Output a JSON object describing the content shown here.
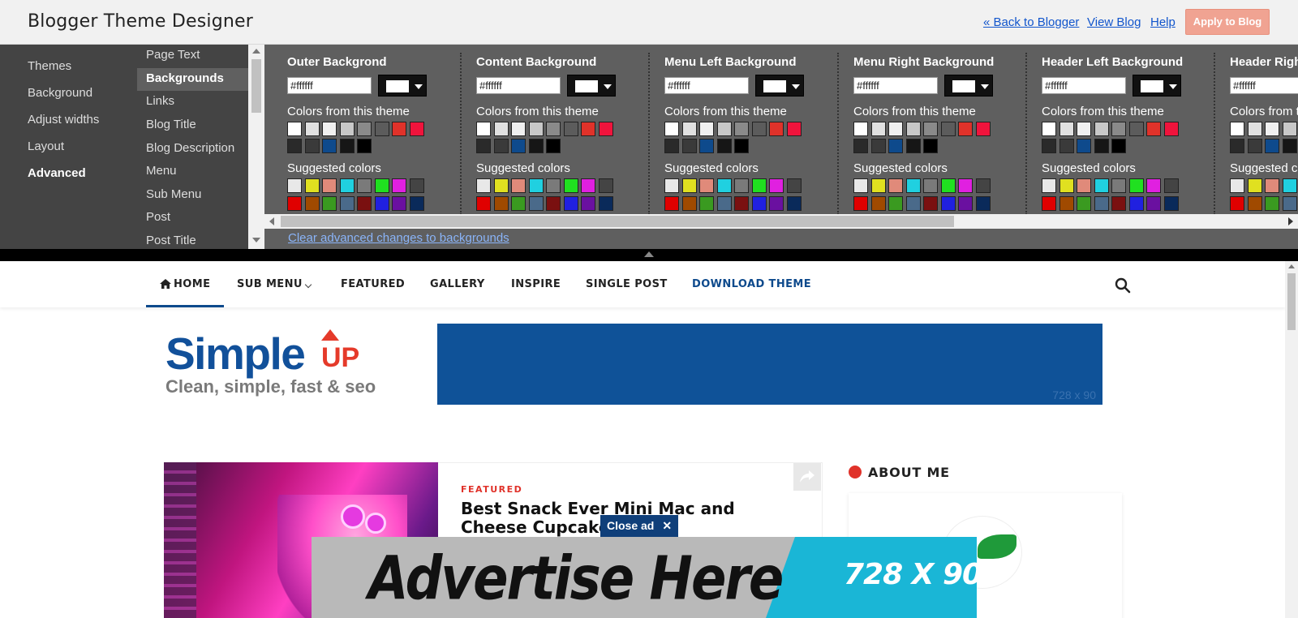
{
  "app": {
    "title": "Blogger Theme Designer",
    "links": {
      "back": "« Back to Blogger",
      "view_blog": "View Blog",
      "help": "Help"
    },
    "apply_button": "Apply to Blog",
    "apply_button_color": "#f0a392"
  },
  "primary_nav": {
    "items": [
      "Themes",
      "Background",
      "Adjust widths",
      "Layout",
      "Advanced"
    ],
    "active": "Advanced"
  },
  "secondary_nav": {
    "items": [
      "Page Text",
      "Backgrounds",
      "Links",
      "Blog Title",
      "Blog Description",
      "Menu",
      "Sub Menu",
      "Post",
      "Post Title"
    ],
    "active": "Backgrounds"
  },
  "editor": {
    "columns": [
      {
        "title": "Outer Backgrond",
        "hex": "#ffffff"
      },
      {
        "title": "Content Background",
        "hex": "#ffffff"
      },
      {
        "title": "Menu Left Background",
        "hex": "#ffffff"
      },
      {
        "title": "Menu Right Background",
        "hex": "#ffffff"
      },
      {
        "title": "Header Left Background",
        "hex": "#ffffff"
      },
      {
        "title": "Header Right Background",
        "hex": "#ffffff"
      }
    ],
    "theme_colors_label": "Colors from this theme",
    "suggested_colors_label": "Suggested colors",
    "theme_colors_row1": [
      "#ffffff",
      "#e0e0e0",
      "#f0f0f0",
      "#c8c8c8",
      "#8a8a8a",
      "#5c5c5c",
      "#e0322a",
      "#f0143c"
    ],
    "theme_colors_row2": [
      "#2a2a2a",
      "#3a3a3a",
      "#0e4a8c",
      "#161616",
      "#000000"
    ],
    "suggested_row1": [
      "#e8e8e8",
      "#e0e020",
      "#e08a7a",
      "#20d0e0",
      "#7a7a7a",
      "#20e020",
      "#e020e0",
      "#444444"
    ],
    "suggested_row2": [
      "#e00000",
      "#a04a00",
      "#3a9a20",
      "#4a6a8a",
      "#7a1010",
      "#2020e0",
      "#6a10a0",
      "#0a2a5a"
    ],
    "clear_link": "Clear advanced changes to backgrounds"
  },
  "preview": {
    "nav": {
      "items": [
        "HOME",
        "SUB MENU",
        "FEATURED",
        "GALLERY",
        "INSPIRE",
        "SINGLE POST",
        "DOWNLOAD THEME"
      ],
      "accent": "#0e4a8c"
    },
    "logo": {
      "main": "Simple",
      "up": "UP",
      "tagline": "Clean, simple, fast & seo"
    },
    "header_ad_label": "728 x 90",
    "post": {
      "category": "FEATURED",
      "title": "Best Snack Ever Mini Mac and Cheese Cupcakes"
    },
    "sidebar_title": "ABOUT ME",
    "float_ad": {
      "text": "Advertise Here",
      "size": "728 X 90",
      "close": "Close ad",
      "close_x": "✕"
    }
  }
}
